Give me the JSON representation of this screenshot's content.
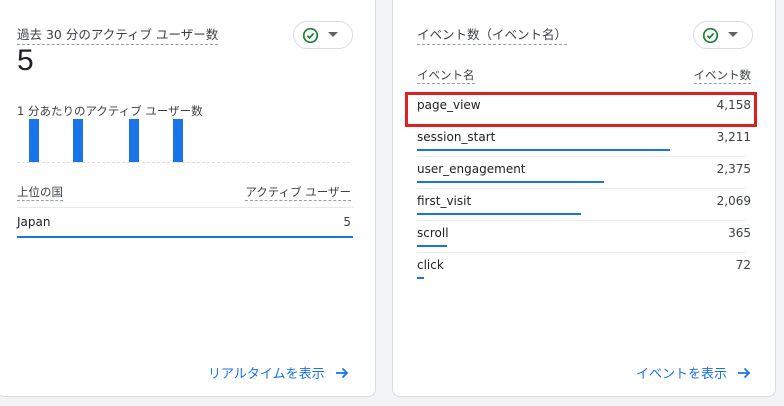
{
  "realtime_card": {
    "title": "過去 30 分のアクティブ ユーザー数",
    "active_users": "5",
    "per_minute_label": "1 分あたりのアクティブ ユーザー数",
    "per_minute_values": [
      1,
      1,
      1,
      1
    ],
    "table": {
      "col_country": "上位の国",
      "col_users": "アクティブ ユーザー",
      "rows": [
        {
          "country": "Japan",
          "users": "5",
          "share": 1.0
        }
      ]
    },
    "footer_link": "リアルタイムを表示"
  },
  "events_card": {
    "title": "イベント数（イベント名）",
    "col_event": "イベント名",
    "col_count": "イベント数",
    "rows": [
      {
        "name": "page_view",
        "count": "4,158",
        "share": 1.0
      },
      {
        "name": "session_start",
        "count": "3,211",
        "share": 0.77
      },
      {
        "name": "user_engagement",
        "count": "2,375",
        "share": 0.57
      },
      {
        "name": "first_visit",
        "count": "2,069",
        "share": 0.5
      },
      {
        "name": "scroll",
        "count": "365",
        "share": 0.09
      },
      {
        "name": "click",
        "count": "72",
        "share": 0.02
      }
    ],
    "footer_link": "イベントを表示"
  },
  "colors": {
    "accent": "#1a73e8",
    "status_ok": "#188038",
    "highlight": "#e0201f"
  },
  "icons": {
    "status": "check-circle-icon",
    "dropdown": "caret-down-icon",
    "link": "arrow-right-icon"
  }
}
